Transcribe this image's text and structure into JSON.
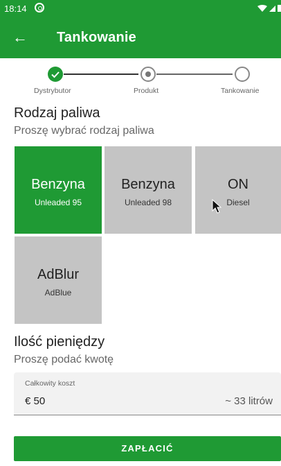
{
  "status_bar": {
    "time": "18:14",
    "sync_icon": "sync-icon",
    "signal_icons": "wifi-signal-battery-icons"
  },
  "app_bar": {
    "title": "Tankowanie",
    "back_icon": "arrow-back-icon",
    "back_glyph": "←"
  },
  "stepper": {
    "steps": [
      {
        "label": "Dystrybutor",
        "state": "done"
      },
      {
        "label": "Produkt",
        "state": "current"
      },
      {
        "label": "Tankowanie",
        "state": "pending"
      }
    ]
  },
  "fuel_section": {
    "title": "Rodzaj paliwa",
    "subtitle": "Proszę wybrać rodzaj paliwa",
    "options": [
      {
        "name": "Benzyna",
        "sub": "Unleaded 95",
        "selected": true
      },
      {
        "name": "Benzyna",
        "sub": "Unleaded 98",
        "selected": false
      },
      {
        "name": "ON",
        "sub": "Diesel",
        "selected": false
      },
      {
        "name": "AdBlur",
        "sub": "AdBlue",
        "selected": false
      }
    ]
  },
  "money_section": {
    "title": "Ilość pieniędzy",
    "subtitle": "Proszę podać kwotę",
    "field": {
      "label": "Całkowity koszt",
      "value": "€ 50",
      "estimate": "~ 33 litrów"
    }
  },
  "pay_button": {
    "label": "ZAPŁACIĆ"
  },
  "colors": {
    "accent": "#1f9a34",
    "tile_inactive": "#c4c4c4",
    "field_bg": "#f2f2f2"
  }
}
